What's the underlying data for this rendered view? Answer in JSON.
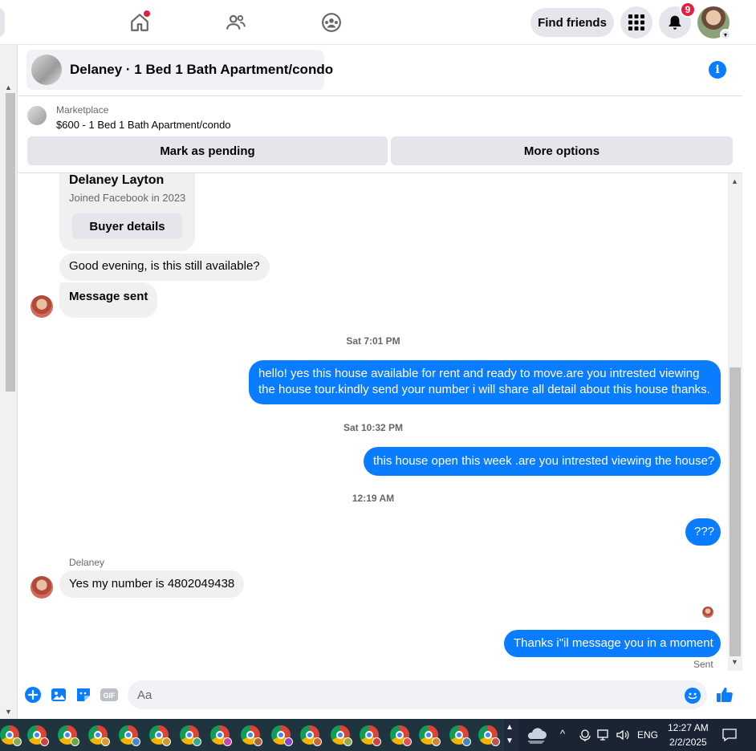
{
  "nav": {
    "find_friends": "Find friends",
    "notification_count": "9"
  },
  "chat_header": {
    "title": "Delaney · 1 Bed 1 Bath Apartment/condo"
  },
  "marketplace": {
    "label": "Marketplace",
    "listing": "$600 - 1 Bed 1 Bath Apartment/condo",
    "mark_pending": "Mark as pending",
    "more_options": "More options"
  },
  "buyer_card": {
    "name": "Delaney Layton",
    "joined": "Joined Facebook in 2023",
    "button": "Buyer details"
  },
  "messages": {
    "m1": "Good evening, is this still available?",
    "m2": "Message sent",
    "ts1": "Sat 7:01 PM",
    "m3_line1": "hello! yes this house available for rent and ready to move.are you intrested viewing",
    "m3_line2": "the house tour.kindly send your number i will share all detail about this house thanks.",
    "ts2": "Sat 10:32 PM",
    "m4": "this house open this week .are you intrested viewing the house?",
    "ts3": "12:19 AM",
    "m5": "???",
    "sender": "Delaney",
    "m6": "Yes my number is 4802049438",
    "m7": "Thanks i\"il message you in a moment",
    "status": "Sent"
  },
  "composer": {
    "placeholder": "Aa"
  },
  "taskbar": {
    "lang": "ENG",
    "time": "12:27 AM",
    "date": "2/2/2025"
  },
  "colors": {
    "accent": "#0a7cff",
    "badge": "#e41e3f",
    "bubble_in": "#f0f0f0"
  }
}
